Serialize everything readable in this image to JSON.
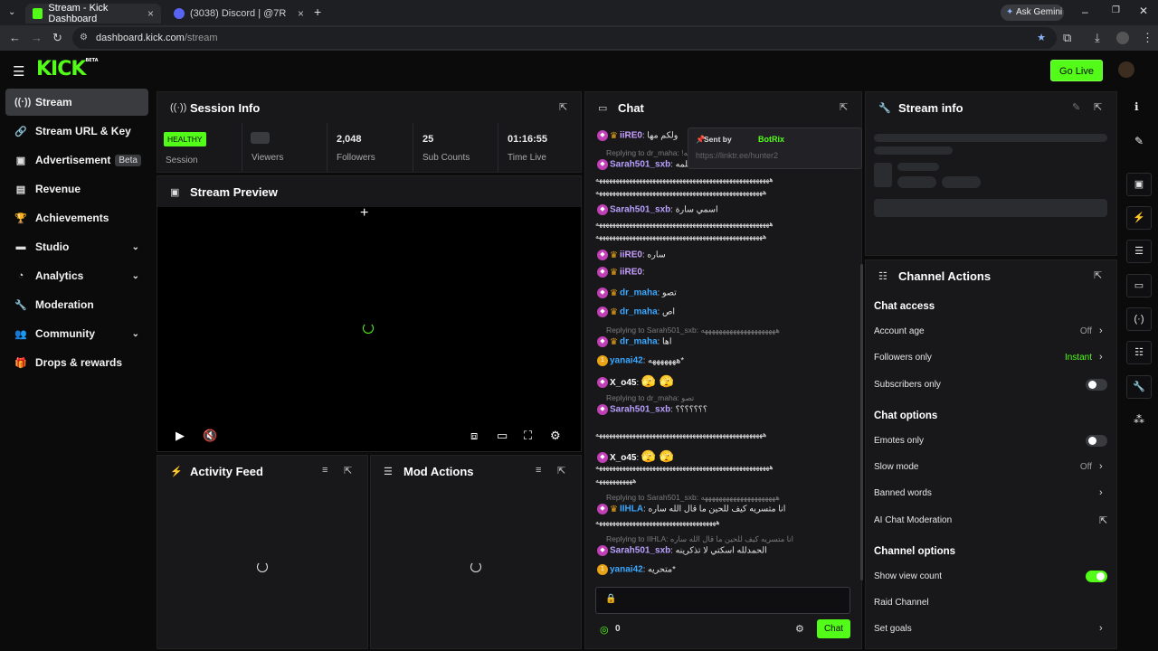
{
  "browser": {
    "tabs": [
      {
        "title": "Stream - Kick Dashboard",
        "active": true
      },
      {
        "title": "(3038) Discord | @7R",
        "active": false
      }
    ],
    "url_domain": "dashboard.kick.com",
    "url_path": "/stream",
    "ask_gemini": "Ask Gemini"
  },
  "header": {
    "logo": "KICK",
    "logo_tag": "BETA",
    "go_live": "Go Live"
  },
  "sidebar": {
    "items": [
      {
        "label": "Stream",
        "icon": "broadcast-icon",
        "glyph": "((·))",
        "active": true
      },
      {
        "label": "Stream URL & Key",
        "icon": "link-icon",
        "glyph": "🔗"
      },
      {
        "label": "Advertisement",
        "icon": "ad-icon",
        "glyph": "▣",
        "badge": "Beta"
      },
      {
        "label": "Revenue",
        "icon": "revenue-icon",
        "glyph": "▤"
      },
      {
        "label": "Achievements",
        "icon": "trophy-icon",
        "glyph": "🏆"
      },
      {
        "label": "Studio",
        "icon": "studio-icon",
        "glyph": "▬",
        "chevron": true
      },
      {
        "label": "Analytics",
        "icon": "analytics-icon",
        "glyph": "◔",
        "chevron": true
      },
      {
        "label": "Moderation",
        "icon": "wrench-icon",
        "glyph": "🔧"
      },
      {
        "label": "Community",
        "icon": "community-icon",
        "glyph": "👥",
        "chevron": true
      },
      {
        "label": "Drops & rewards",
        "icon": "drops-icon",
        "glyph": "🎁"
      }
    ]
  },
  "session": {
    "title": "Session Info",
    "status": "HEALTHY",
    "stats": [
      {
        "value": "",
        "label": "Session"
      },
      {
        "value": "",
        "label": "Viewers"
      },
      {
        "value": "2,048",
        "label": "Followers"
      },
      {
        "value": "25",
        "label": "Sub Counts"
      },
      {
        "value": "01:16:55",
        "label": "Time Live"
      }
    ]
  },
  "preview": {
    "title": "Stream Preview"
  },
  "activity": {
    "title": "Activity Feed"
  },
  "mod_actions": {
    "title": "Mod Actions"
  },
  "chat": {
    "title": "Chat",
    "sent_by": "Sent by",
    "bot": "BotRix",
    "bot_link": "https://linktr.ee/hunter2",
    "messages": [
      {
        "type": "msg",
        "user": "iiRE0",
        "color": "#c8a0ff",
        "text": "ولكم مها"
      },
      {
        "type": "reply",
        "text": "Replying to dr_maha: !كلمه"
      },
      {
        "type": "msg",
        "user": "Sarah501_sxb",
        "color": "#b9a0ff",
        "text": "كلمه"
      },
      {
        "type": "eggs",
        "text": "ههههههههههههههههههههههههههههههههههههههههههههههههههههه"
      },
      {
        "type": "eggs",
        "text": "ههههههههههههههههههههههههههههههههههههههههههههههههههه"
      },
      {
        "type": "msg",
        "user": "Sarah501_sxb",
        "color": "#b9a0ff",
        "text": "اسمي سارة"
      },
      {
        "type": "eggs",
        "text": "ههههههههههههههههههههههههههههههههههههههههههههههههههههه"
      },
      {
        "type": "eggs",
        "text": "ههههههههههههههههههههههههههههههههههههههههههههههههههه"
      },
      {
        "type": "msg",
        "user": "iiRE0",
        "color": "#c8a0ff",
        "text": "ساره"
      },
      {
        "type": "msg",
        "user": "iiRE0",
        "color": "#c8a0ff",
        "text": ""
      },
      {
        "type": "msg",
        "user": "dr_maha",
        "color": "#3aa8ff",
        "text": "تصو"
      },
      {
        "type": "msg",
        "user": "dr_maha",
        "color": "#3aa8ff",
        "text": "اص"
      },
      {
        "type": "reply",
        "text": "Replying to Sarah501_sxb: هههههههههههههههههههههه"
      },
      {
        "type": "msg",
        "user": "dr_maha",
        "color": "#3aa8ff",
        "text": "اها"
      },
      {
        "type": "msg",
        "user": "yanai42",
        "color": "#3aa8ff",
        "text": "هههههههه*"
      },
      {
        "type": "msg",
        "user": "X_o45",
        "color": "#ffffff",
        "text": ""
      },
      {
        "type": "reply",
        "text": "Replying to dr_maha: تصو"
      },
      {
        "type": "msg",
        "user": "Sarah501_sxb",
        "color": "#b9a0ff",
        "text": "؟؟؟؟؟؟؟"
      },
      {
        "type": "eggs",
        "text": "ههههههههههههههههههههههههههههههههههههههههههههههههههه"
      },
      {
        "type": "msg",
        "user": "X_o45",
        "color": "#ffffff",
        "text": ""
      },
      {
        "type": "eggs",
        "text": "ههههههههههههههههههههههههههههههههههههههههههههههههههههه"
      },
      {
        "type": "eggs",
        "text": "هههههههههههه"
      },
      {
        "type": "reply",
        "text": "Replying to Sarah501_sxb: هههههههههههههههههههههه"
      },
      {
        "type": "msg",
        "user": "IIHLA",
        "color": "#3aa8ff",
        "text": "انا متسريه كيف للحين ما قال الله ساره"
      },
      {
        "type": "eggs",
        "text": "ههههههههههههههههههههههههههههههههههههه"
      },
      {
        "type": "reply",
        "text": "Replying to IIHLA: انا متسريه كيف للحين ما قال الله ساره"
      },
      {
        "type": "msg",
        "user": "Sarah501_sxb",
        "color": "#b9a0ff",
        "text": "الحمدلله اسكتي لا تذكرينه"
      },
      {
        "type": "msg",
        "user": "yanai42",
        "color": "#3aa8ff",
        "text": "متحريه*"
      }
    ],
    "input_placeholder": "",
    "count": "0",
    "send_label": "Chat"
  },
  "stream_info": {
    "title": "Stream info"
  },
  "channel_actions": {
    "title": "Channel Actions",
    "sections": [
      {
        "heading": "Chat access"
      },
      {
        "label": "Account age",
        "value": "Off",
        "kind": "chevron"
      },
      {
        "label": "Followers only",
        "value": "Instant",
        "kind": "chevron",
        "value_color": "#53fc18"
      },
      {
        "label": "Subscribers only",
        "kind": "toggle",
        "on": false
      },
      {
        "heading": "Chat options"
      },
      {
        "label": "Emotes only",
        "kind": "toggle",
        "on": false
      },
      {
        "label": "Slow mode",
        "value": "Off",
        "kind": "chevron"
      },
      {
        "label": "Banned words",
        "kind": "chevron"
      },
      {
        "label": "AI Chat Moderation",
        "kind": "external"
      },
      {
        "heading": "Channel options"
      },
      {
        "label": "Show view count",
        "kind": "toggle",
        "on": true
      },
      {
        "label": "Raid Channel",
        "kind": "none"
      },
      {
        "label": "Set goals",
        "kind": "chevron"
      }
    ]
  },
  "colors": {
    "accent": "#53fc18",
    "panel": "#18181b",
    "background": "#0b0b0c"
  }
}
